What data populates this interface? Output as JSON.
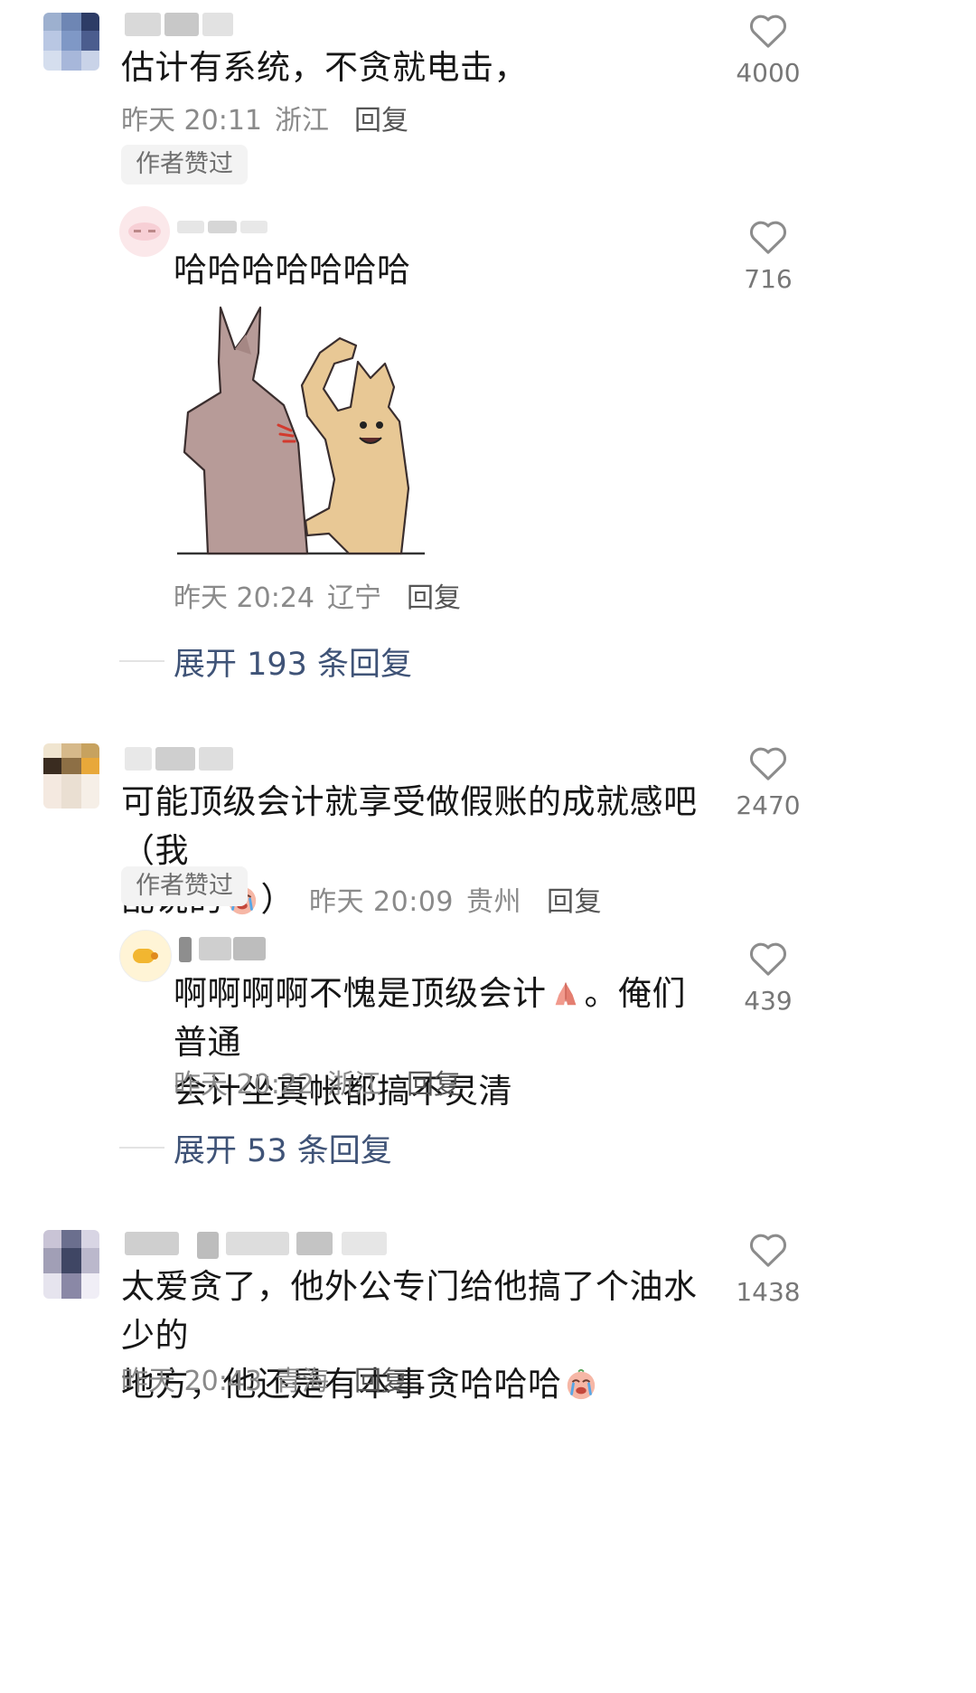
{
  "comments": [
    {
      "text": "估计有系统，不贪就电击，",
      "time": "昨天 20:11",
      "location": "浙江",
      "reply_label": "回复",
      "badge": "作者赞过",
      "likes": "4000",
      "replies": [
        {
          "text": "哈哈哈哈哈哈哈",
          "time": "昨天 20:24",
          "location": "辽宁",
          "reply_label": "回复",
          "likes": "716",
          "has_image": true
        }
      ],
      "expand_label": "展开 193 条回复"
    },
    {
      "text_line1": "可能顶级会计就享受做假账的成就感吧（我",
      "text_line2": "乱说的",
      "text_tail": "）",
      "time": "昨天 20:09",
      "location": "贵州",
      "reply_label": "回复",
      "badge": "作者赞过",
      "likes": "2470",
      "replies": [
        {
          "text_line1": "啊啊啊啊不愧是顶级会计",
          "text_line1_tail": "。俺们普通",
          "text_line2": "会计坐真帐都搞不灵清",
          "time": "昨天 20:22",
          "location": "浙江",
          "reply_label": "回复",
          "likes": "439"
        }
      ],
      "expand_label": "展开 53 条回复"
    },
    {
      "text_line1": "太爱贪了，他外公专门给他搞了个油水少的",
      "text_line2": "地方，他还是有本事贪哈哈哈",
      "time": "昨天 20:43",
      "location": "青海",
      "reply_label": "回复",
      "likes": "1438"
    }
  ],
  "icons": {
    "like": "heart-outline-icon",
    "emoji_cry": "crying-face-emoji",
    "emoji_pray": "praying-hands-emoji"
  },
  "colors": {
    "link": "#3f5377",
    "meta": "#8a8a8a",
    "badge_bg": "#f3f3f3"
  }
}
